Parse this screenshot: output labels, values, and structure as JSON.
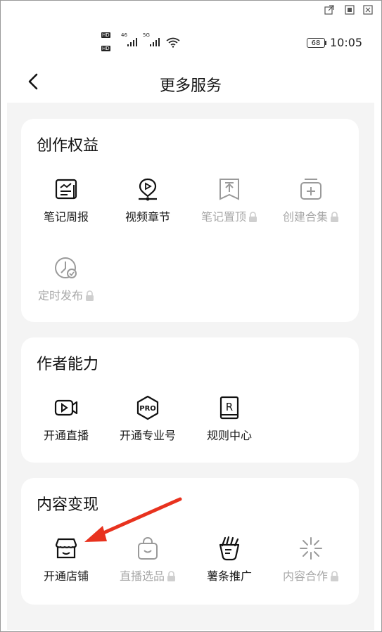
{
  "window_controls": [
    "popout-icon",
    "maximize-icon",
    "close-icon"
  ],
  "status_bar": {
    "hd1": "HD",
    "hd2": "HD",
    "sig1": "46",
    "sig2": "5G",
    "battery": "68",
    "time": "10:05"
  },
  "header": {
    "title": "更多服务"
  },
  "sections": [
    {
      "title": "创作权益",
      "items": [
        {
          "label": "笔记周报",
          "icon": "report-icon",
          "locked": false
        },
        {
          "label": "视频章节",
          "icon": "video-chapter-icon",
          "locked": false
        },
        {
          "label": "笔记置顶",
          "icon": "pin-top-icon",
          "locked": true
        },
        {
          "label": "创建合集",
          "icon": "collection-add-icon",
          "locked": true
        },
        {
          "label": "定时发布",
          "icon": "schedule-icon",
          "locked": true
        }
      ]
    },
    {
      "title": "作者能力",
      "items": [
        {
          "label": "开通直播",
          "icon": "live-video-icon",
          "locked": false
        },
        {
          "label": "开通专业号",
          "icon": "pro-badge-icon",
          "locked": false
        },
        {
          "label": "规则中心",
          "icon": "rules-book-icon",
          "locked": false
        }
      ]
    },
    {
      "title": "内容变现",
      "items": [
        {
          "label": "开通店铺",
          "icon": "store-icon",
          "locked": false
        },
        {
          "label": "直播选品",
          "icon": "shopping-bag-icon",
          "locked": true
        },
        {
          "label": "薯条推广",
          "icon": "fries-promote-icon",
          "locked": false
        },
        {
          "label": "内容合作",
          "icon": "sparkle-cooperation-icon",
          "locked": true
        }
      ]
    }
  ],
  "colors": {
    "accent_arrow": "#e8321e",
    "disabled": "#a8a8a8",
    "card_bg": "#ffffff",
    "page_bg": "#f4f4f4"
  }
}
